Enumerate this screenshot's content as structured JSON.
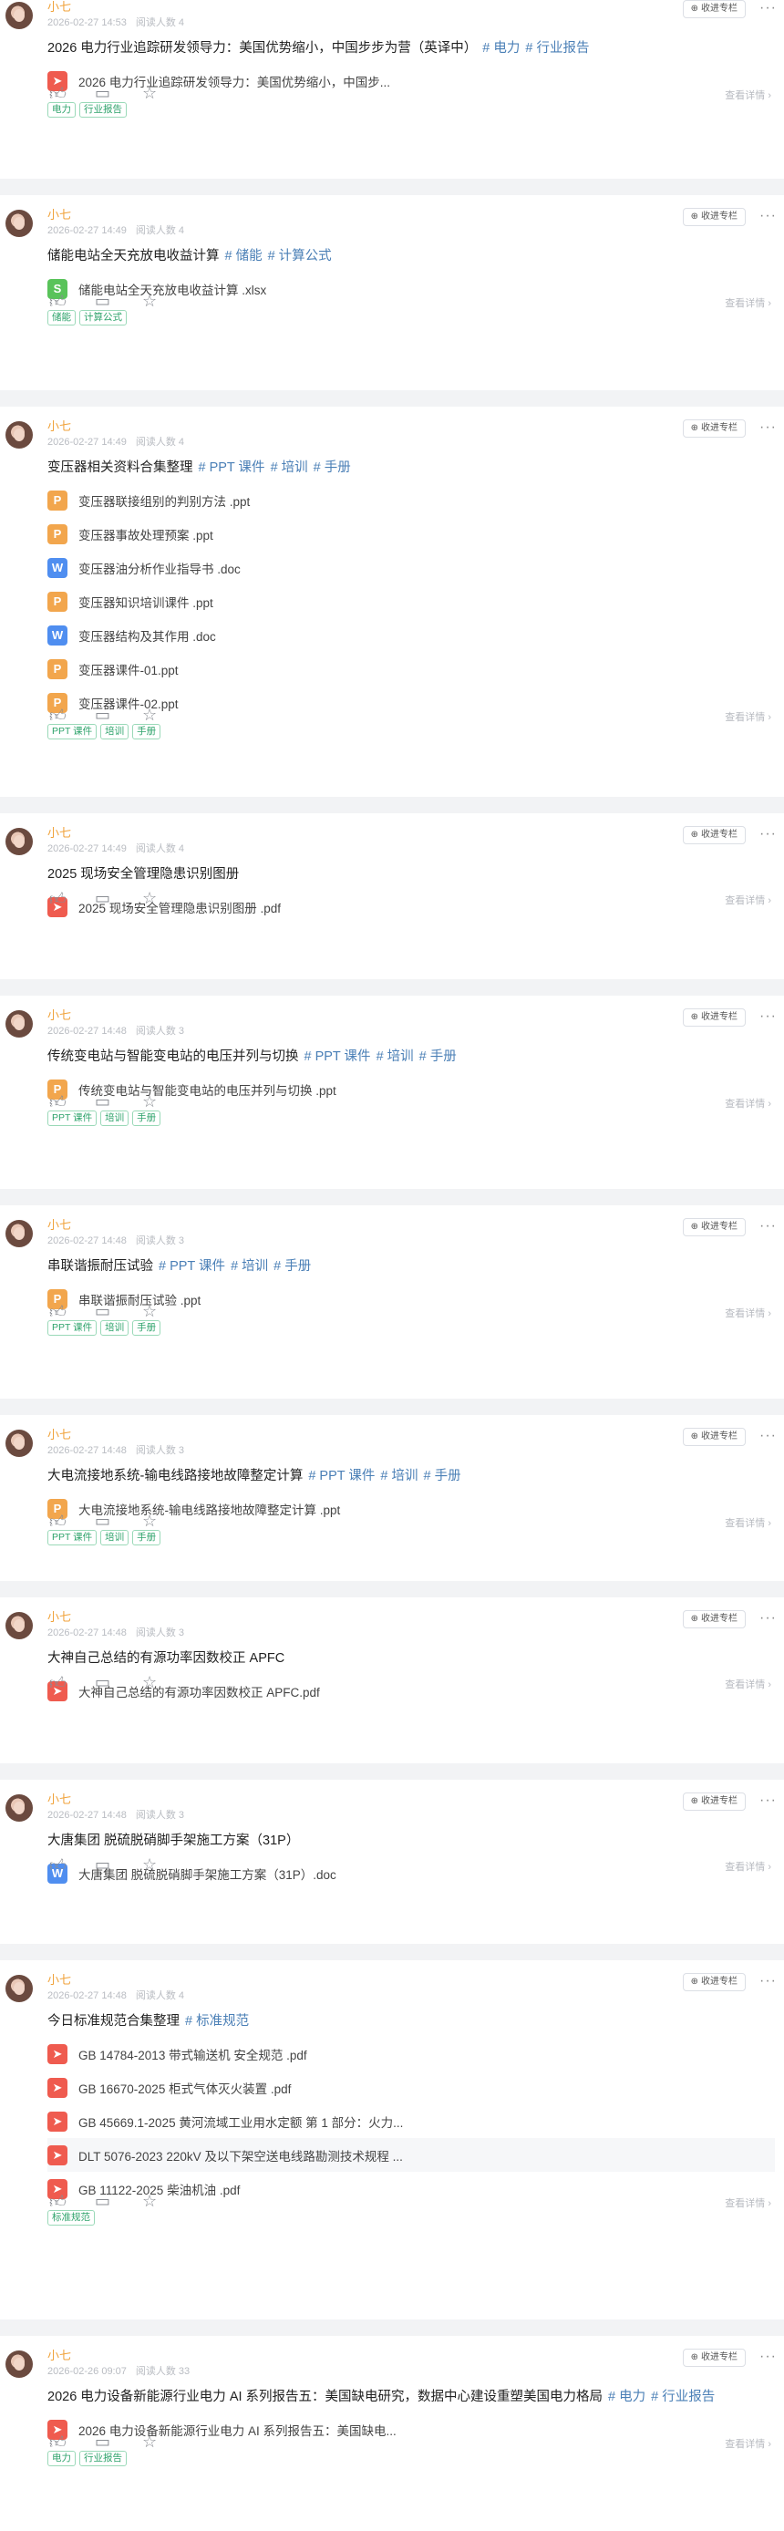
{
  "posts": [
    {
      "author": "小七",
      "time": "2026-02-27 14:53",
      "reads": "阅读人数 4",
      "collect_label": "收进专栏",
      "title": "2026 电力行业追踪研发领导力：美国优势缩小，中国步步为营（英译中）",
      "title_tags": [
        "# 电力",
        "# 行业报告"
      ],
      "files": [
        {
          "type": "pdf",
          "name": "2026 电力行业追踪研发领导力：美国优势缩小，中国步..."
        }
      ],
      "tags": [
        "电力",
        "行业报告"
      ]
    },
    {
      "author": "小七",
      "time": "2026-02-27 14:49",
      "reads": "阅读人数 4",
      "collect_label": "收进专栏",
      "title": "储能电站全天充放电收益计算",
      "title_tags": [
        "# 储能",
        "# 计算公式"
      ],
      "files": [
        {
          "type": "xls",
          "name": "储能电站全天充放电收益计算 .xlsx"
        }
      ],
      "tags": [
        "储能",
        "计算公式"
      ]
    },
    {
      "author": "小七",
      "time": "2026-02-27 14:49",
      "reads": "阅读人数 4",
      "collect_label": "收进专栏",
      "title": "变压器相关资料合集整理",
      "title_tags": [
        "# PPT 课件",
        "# 培训",
        "# 手册"
      ],
      "files": [
        {
          "type": "ppt",
          "name": "变压器联接组别的判别方法 .ppt"
        },
        {
          "type": "ppt",
          "name": "变压器事故处理预案 .ppt"
        },
        {
          "type": "doc",
          "name": "变压器油分析作业指导书 .doc"
        },
        {
          "type": "ppt",
          "name": "变压器知识培训课件 .ppt"
        },
        {
          "type": "doc",
          "name": "变压器结构及其作用 .doc"
        },
        {
          "type": "ppt",
          "name": "变压器课件-01.ppt"
        },
        {
          "type": "ppt",
          "name": "变压器课件-02.ppt"
        }
      ],
      "tags": [
        "PPT 课件",
        "培训",
        "手册"
      ]
    },
    {
      "author": "小七",
      "time": "2026-02-27 14:49",
      "reads": "阅读人数 4",
      "collect_label": "收进专栏",
      "title": "2025 现场安全管理隐患识别图册",
      "title_tags": [],
      "files": [
        {
          "type": "pdf",
          "name": "2025 现场安全管理隐患识别图册 .pdf"
        }
      ],
      "tags": []
    },
    {
      "author": "小七",
      "time": "2026-02-27 14:48",
      "reads": "阅读人数 3",
      "collect_label": "收进专栏",
      "title": "传统变电站与智能变电站的电压并列与切换",
      "title_tags": [
        "# PPT 课件",
        "# 培训",
        "# 手册"
      ],
      "files": [
        {
          "type": "ppt",
          "name": "传统变电站与智能变电站的电压并列与切换 .ppt"
        }
      ],
      "tags": [
        "PPT 课件",
        "培训",
        "手册"
      ]
    },
    {
      "author": "小七",
      "time": "2026-02-27 14:48",
      "reads": "阅读人数 3",
      "collect_label": "收进专栏",
      "title": "串联谐振耐压试验",
      "title_tags": [
        "# PPT 课件",
        "# 培训",
        "# 手册"
      ],
      "files": [
        {
          "type": "ppt",
          "name": "串联谐振耐压试验 .ppt"
        }
      ],
      "tags": [
        "PPT 课件",
        "培训",
        "手册"
      ]
    },
    {
      "author": "小七",
      "time": "2026-02-27 14:48",
      "reads": "阅读人数 3",
      "collect_label": "收进专栏",
      "title": "大电流接地系统-输电线路接地故障整定计算",
      "title_tags": [
        "# PPT 课件",
        "# 培训",
        "# 手册"
      ],
      "files": [
        {
          "type": "ppt",
          "name": "大电流接地系统-输电线路接地故障整定计算 .ppt"
        }
      ],
      "tags": [
        "PPT 课件",
        "培训",
        "手册"
      ]
    },
    {
      "author": "小七",
      "time": "2026-02-27 14:48",
      "reads": "阅读人数 3",
      "collect_label": "收进专栏",
      "title": "大神自己总结的有源功率因数校正 APFC",
      "title_tags": [],
      "files": [
        {
          "type": "pdf",
          "name": "大神自己总结的有源功率因数校正 APFC.pdf"
        }
      ],
      "tags": []
    },
    {
      "author": "小七",
      "time": "2026-02-27 14:48",
      "reads": "阅读人数 3",
      "collect_label": "收进专栏",
      "title": "大唐集团 脱硫脱硝脚手架施工方案（31P）",
      "title_tags": [],
      "files": [
        {
          "type": "doc",
          "name": "大唐集团 脱硫脱硝脚手架施工方案（31P）.doc"
        }
      ],
      "tags": []
    },
    {
      "author": "小七",
      "time": "2026-02-27 14:48",
      "reads": "阅读人数 4",
      "collect_label": "收进专栏",
      "title": "今日标准规范合集整理",
      "title_tags": [
        "# 标准规范"
      ],
      "files": [
        {
          "type": "pdf",
          "name": "GB 14784-2013 带式输送机 安全规范 .pdf"
        },
        {
          "type": "pdf",
          "name": "GB 16670-2025 柜式气体灭火装置 .pdf"
        },
        {
          "type": "pdf",
          "name": "GB 45669.1-2025 黄河流域工业用水定额 第 1 部分：火力..."
        },
        {
          "type": "pdf",
          "name": "DLT 5076-2023 220kV 及以下架空送电线路勘测技术规程 ...",
          "highlight": true
        },
        {
          "type": "pdf",
          "name": "GB 11122-2025 柴油机油 .pdf"
        }
      ],
      "tags": [
        "标准规范"
      ]
    },
    {
      "author": "小七",
      "time": "2026-02-26 09:07",
      "reads": "阅读人数 33",
      "collect_label": "收进专栏",
      "title": "2026 电力设备新能源行业电力 AI 系列报告五：美国缺电研究，数据中心建设重塑美国电力格局",
      "title_tags": [
        "# 电力",
        "# 行业报告"
      ],
      "files": [
        {
          "type": "pdf",
          "name": "2026 电力设备新能源行业电力 AI 系列报告五：美国缺电..."
        }
      ],
      "tags": [
        "电力",
        "行业报告"
      ]
    }
  ],
  "detail_label": "查看详情 ›",
  "icons": {
    "like": "thumb-up-icon",
    "comment": "comment-icon",
    "star": "star-icon",
    "more": "more-icon",
    "collect": "collect-icon"
  },
  "colors": {
    "author": "#f0a23a",
    "tag_link": "#4a7fb6",
    "chip": "#2ea36b",
    "pdf": "#ef5b4f",
    "ppt": "#f2a64d",
    "doc": "#4f8ef0",
    "xls": "#59c35a"
  }
}
